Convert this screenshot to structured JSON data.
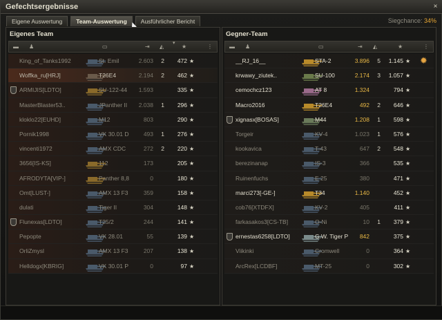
{
  "window": {
    "title": "Gefechtsergebnisse",
    "close": "×"
  },
  "tabs": [
    {
      "label": "Eigene Auswertung"
    },
    {
      "label": "Team-Auswertung"
    },
    {
      "label": "Ausführlicher Bericht"
    }
  ],
  "win_chance": {
    "label": "Siegchance:",
    "value": "34%"
  },
  "own_team": {
    "title": "Eigenes Team",
    "rows": [
      {
        "player": "King_of_Tanks1992",
        "tank": "St. Emil",
        "dmg": "2.603",
        "kills": "2",
        "xp": "472",
        "state": "dead",
        "clan": false,
        "tank_color": "#4a5a6a"
      },
      {
        "player": "Woffka_ru[HRJ]",
        "tank": "T26E4",
        "dmg": "2.194",
        "kills": "2",
        "xp": "462",
        "state": "self",
        "clan": false,
        "tank_color": "#6a5a4a"
      },
      {
        "player": "ARMIJIS[LDTO]",
        "tank": "SU-122-44",
        "dmg": "1.593",
        "kills": "",
        "xp": "335",
        "state": "dead",
        "clan": true,
        "tank_color": "#8a6a2a"
      },
      {
        "player": "MasterBlaster53..",
        "tank": "JPanther II",
        "dmg": "2.038",
        "kills": "1",
        "xp": "296",
        "state": "dead",
        "clan": false,
        "tank_color": "#4a5a6a"
      },
      {
        "player": "kloklo22[EUHD]",
        "tank": "M12",
        "dmg": "803",
        "kills": "",
        "xp": "290",
        "state": "dead",
        "clan": false,
        "tank_color": "#4a5a6a"
      },
      {
        "player": "Pornik1998",
        "tank": "VK 30.01 D",
        "dmg": "493",
        "kills": "1",
        "xp": "276",
        "state": "dead",
        "clan": false,
        "tank_color": "#4a5a6a"
      },
      {
        "player": "vincenti1972",
        "tank": "AMX CDC",
        "dmg": "272",
        "kills": "2",
        "xp": "220",
        "state": "dead",
        "clan": false,
        "tank_color": "#4a5a6a"
      },
      {
        "player": "3656[IS-KS]",
        "tank": "112",
        "dmg": "173",
        "kills": "",
        "xp": "205",
        "state": "dead",
        "clan": false,
        "tank_color": "#8a6a2a"
      },
      {
        "player": "AFRODYTA[VIP-]",
        "tank": "Panther 8,8",
        "dmg": "0",
        "kills": "",
        "xp": "180",
        "state": "dead",
        "clan": false,
        "tank_color": "#8a6a2a"
      },
      {
        "player": "Omt[LUST-]",
        "tank": "AMX 13 F3",
        "dmg": "359",
        "kills": "",
        "xp": "158",
        "state": "dead",
        "clan": false,
        "tank_color": "#4a5a6a"
      },
      {
        "player": "dulati",
        "tank": "Tiger II",
        "dmg": "304",
        "kills": "",
        "xp": "148",
        "state": "dead",
        "clan": false,
        "tank_color": "#4a5a6a"
      },
      {
        "player": "Flunexas[LDTO]",
        "tank": "T25/2",
        "dmg": "244",
        "kills": "",
        "xp": "141",
        "state": "dead",
        "clan": true,
        "tank_color": "#4a5a6a"
      },
      {
        "player": "Pepopte",
        "tank": "VK 28.01",
        "dmg": "55",
        "kills": "",
        "xp": "139",
        "state": "dead",
        "clan": false,
        "tank_color": "#4a5a6a"
      },
      {
        "player": "OrliZmysl",
        "tank": "AMX 13 F3",
        "dmg": "207",
        "kills": "",
        "xp": "138",
        "state": "dead",
        "clan": false,
        "tank_color": "#4a5a6a"
      },
      {
        "player": "Helldogx[KBRIG]",
        "tank": "VK 30.01 P",
        "dmg": "0",
        "kills": "",
        "xp": "97",
        "state": "dead",
        "clan": false,
        "tank_color": "#4a5a6a"
      }
    ]
  },
  "enemy_team": {
    "title": "Gegner-Team",
    "rows": [
      {
        "player": "__RJ_16__",
        "tank": "STA-2",
        "dmg": "3.896",
        "kills": "5",
        "xp": "1.145",
        "state": "alive",
        "clan": false,
        "tank_color": "#b88a2a",
        "top": true
      },
      {
        "player": "krwawy_ziutek..",
        "tank": "SU-100",
        "dmg": "2.174",
        "kills": "3",
        "xp": "1.057",
        "state": "alive",
        "clan": false,
        "tank_color": "#6a7a4a"
      },
      {
        "player": "cemochcz123",
        "tank": "AT 8",
        "dmg": "1.324",
        "kills": "",
        "xp": "794",
        "state": "alive",
        "clan": false,
        "tank_color": "#9a6a8a"
      },
      {
        "player": "Macro2016",
        "tank": "T26E4",
        "dmg": "492",
        "kills": "2",
        "xp": "646",
        "state": "alive",
        "clan": false,
        "tank_color": "#b88a2a"
      },
      {
        "player": "xignasx[BOSAS]",
        "tank": "M44",
        "dmg": "1.208",
        "kills": "1",
        "xp": "598",
        "state": "alive",
        "clan": true,
        "tank_color": "#6a7a5a"
      },
      {
        "player": "Torgeir",
        "tank": "KV-4",
        "dmg": "1.023",
        "kills": "1",
        "xp": "576",
        "state": "dead",
        "clan": false,
        "tank_color": "#4a5a6a"
      },
      {
        "player": "kookavica",
        "tank": "T-43",
        "dmg": "647",
        "kills": "2",
        "xp": "548",
        "state": "dead",
        "clan": false,
        "tank_color": "#4a5a6a"
      },
      {
        "player": "berezinanap",
        "tank": "IS-3",
        "dmg": "366",
        "kills": "",
        "xp": "535",
        "state": "dead",
        "clan": false,
        "tank_color": "#4a5a6a"
      },
      {
        "player": "Ruinenfuchs",
        "tank": "E 25",
        "dmg": "380",
        "kills": "",
        "xp": "471",
        "state": "dead",
        "clan": false,
        "tank_color": "#4a5a6a"
      },
      {
        "player": "marci273[-GE-]",
        "tank": "T34",
        "dmg": "1.140",
        "kills": "",
        "xp": "452",
        "state": "alive",
        "clan": false,
        "tank_color": "#b88a2a"
      },
      {
        "player": "cob76[XTDFX]",
        "tank": "KV-2",
        "dmg": "405",
        "kills": "",
        "xp": "411",
        "state": "dead",
        "clan": false,
        "tank_color": "#4a5a6a"
      },
      {
        "player": "farkasakos3[CS-TB]",
        "tank": "O-Ni",
        "dmg": "10",
        "kills": "1",
        "xp": "379",
        "state": "dead",
        "clan": false,
        "tank_color": "#4a5a6a"
      },
      {
        "player": "ernestas6258[LDTO]",
        "tank": "G.W. Tiger P",
        "dmg": "842",
        "kills": "",
        "xp": "375",
        "state": "alive",
        "clan": true,
        "tank_color": "#7a8a8a"
      },
      {
        "player": "Viikinki",
        "tank": "Cromwell",
        "dmg": "0",
        "kills": "",
        "xp": "364",
        "state": "dead",
        "clan": false,
        "tank_color": "#4a5a6a"
      },
      {
        "player": "ArcRex[LCDBF]",
        "tank": "MT-25",
        "dmg": "0",
        "kills": "",
        "xp": "302",
        "state": "dead",
        "clan": false,
        "tank_color": "#4a5a6a"
      }
    ]
  }
}
